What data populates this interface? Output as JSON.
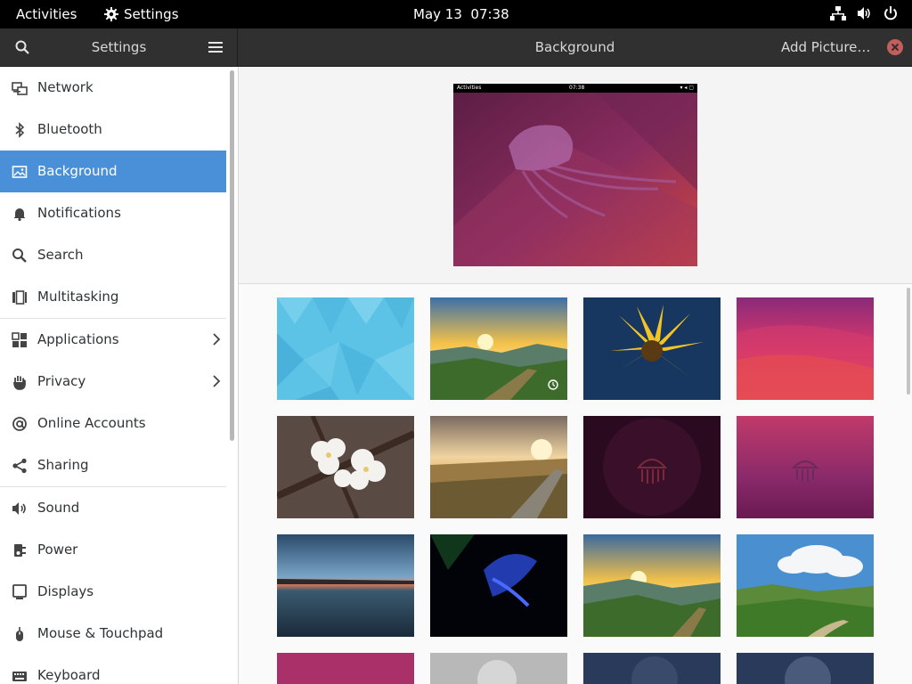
{
  "topbar": {
    "activities": "Activities",
    "app_name": "Settings",
    "clock": "May 13  07:38"
  },
  "headerbar": {
    "sidebar_title": "Settings",
    "page_title": "Background",
    "add_picture": "Add Picture…"
  },
  "sidebar": {
    "items": [
      {
        "label": "Network"
      },
      {
        "label": "Bluetooth"
      },
      {
        "label": "Background"
      },
      {
        "label": "Notifications"
      },
      {
        "label": "Search"
      },
      {
        "label": "Multitasking"
      },
      {
        "label": "Applications"
      },
      {
        "label": "Privacy"
      },
      {
        "label": "Online Accounts"
      },
      {
        "label": "Sharing"
      },
      {
        "label": "Sound"
      },
      {
        "label": "Power"
      },
      {
        "label": "Displays"
      },
      {
        "label": "Mouse & Touchpad"
      },
      {
        "label": "Keyboard"
      }
    ]
  },
  "preview": {
    "activities": "Activities",
    "clock": "07:38"
  },
  "colors": {
    "accent": "#4a90d9",
    "headerbar": "#303030",
    "topbar": "#000000",
    "close": "#c55d5d"
  }
}
